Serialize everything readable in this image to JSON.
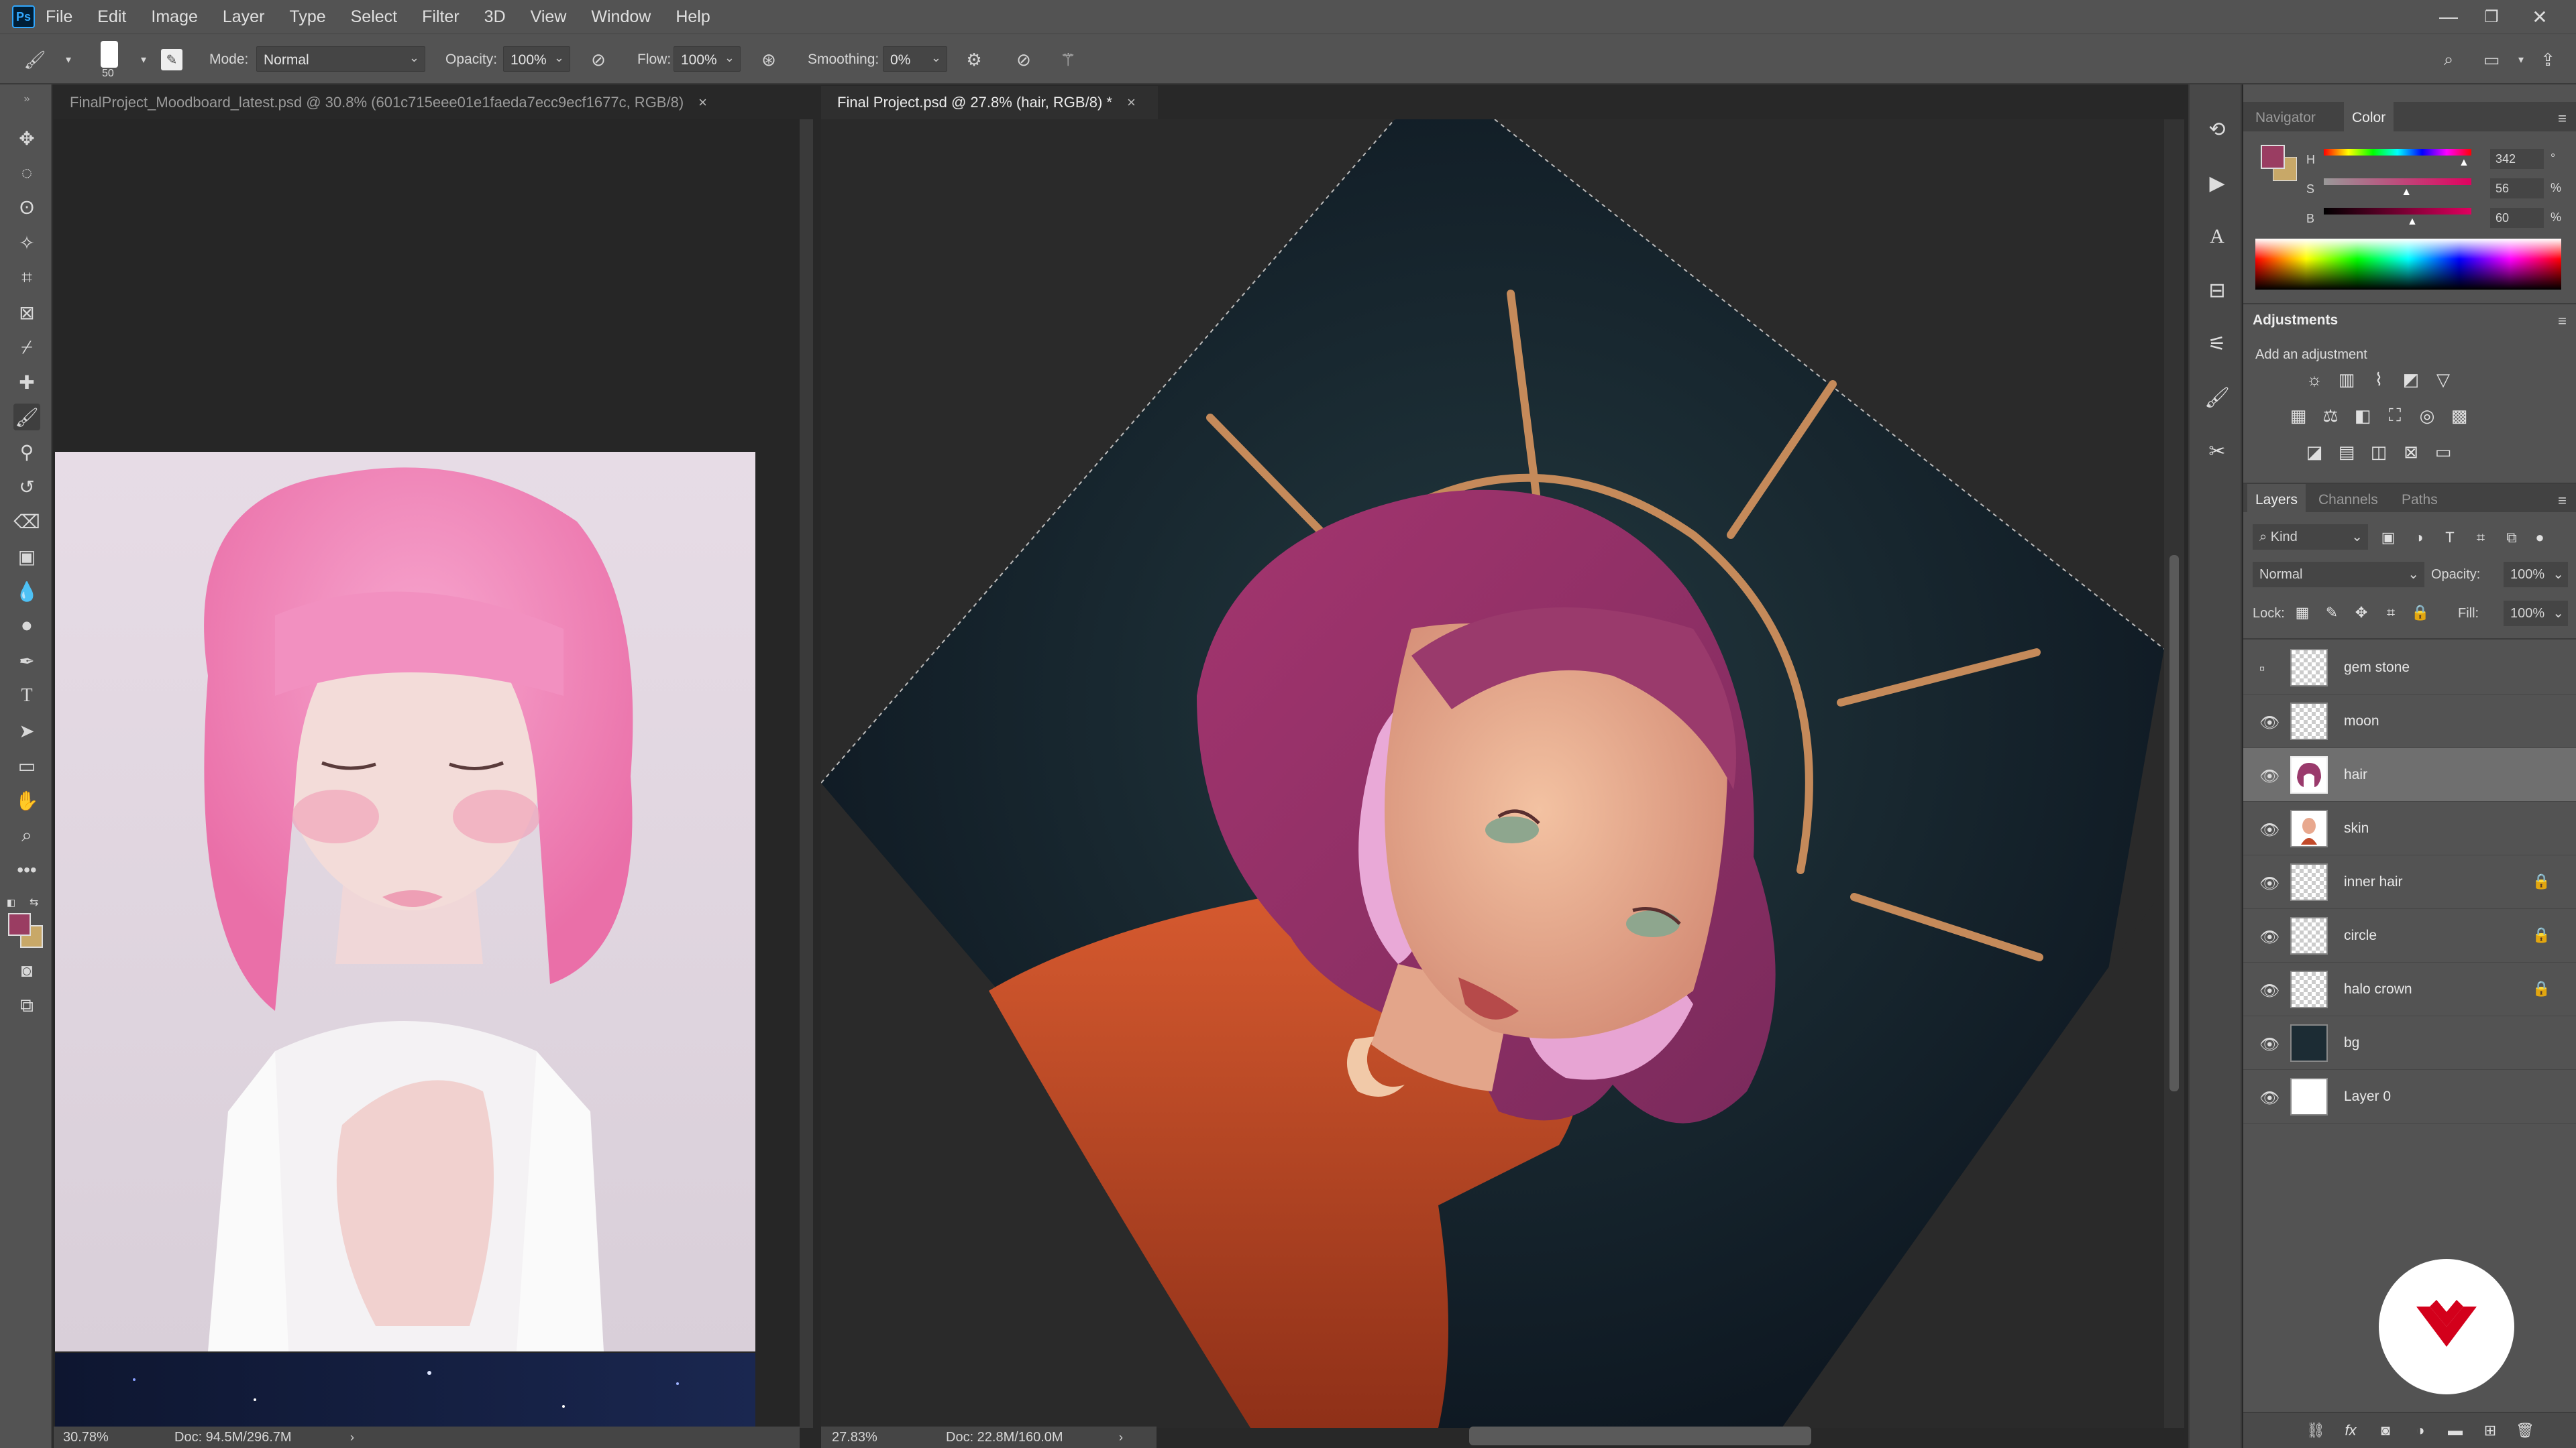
{
  "menu": [
    "File",
    "Edit",
    "Image",
    "Layer",
    "Type",
    "Select",
    "Filter",
    "3D",
    "View",
    "Window",
    "Help"
  ],
  "app_logo": "Ps",
  "window_controls": {
    "minimize": "—",
    "restore": "❐",
    "close": "✕"
  },
  "options": {
    "brush_size": "50",
    "mode_label": "Mode:",
    "mode_value": "Normal",
    "opacity_label": "Opacity:",
    "opacity_value": "100%",
    "flow_label": "Flow:",
    "flow_value": "100%",
    "smoothing_label": "Smoothing:",
    "smoothing_value": "0%"
  },
  "tabs": [
    {
      "title": "FinalProject_Moodboard_latest.psd @ 30.8% (601c715eee01e1faeda7ecc9ecf1677c, RGB/8)",
      "close": "×"
    },
    {
      "title": "Final Project.psd @ 27.8% (hair, RGB/8) *",
      "close": "×"
    }
  ],
  "status": {
    "doc1_zoom": "30.78%",
    "doc1_size": "Doc: 94.5M/296.7M",
    "doc2_zoom": "27.83%",
    "doc2_size": "Doc: 22.8M/160.0M"
  },
  "navigator_tabs": {
    "navigator": "Navigator",
    "color": "Color"
  },
  "color": {
    "h_label": "H",
    "h_value": "342",
    "h_unit": "°",
    "s_label": "S",
    "s_value": "56",
    "s_unit": "%",
    "b_label": "B",
    "b_value": "60",
    "b_unit": "%",
    "h_fraction": 0.95,
    "s_fraction": 0.56,
    "b_fraction": 0.6,
    "fg": "#9a3d62",
    "bg": "#c8a868"
  },
  "adjustments": {
    "title": "Adjustments",
    "subtitle": "Add an adjustment"
  },
  "layers_tabs": {
    "layers": "Layers",
    "channels": "Channels",
    "paths": "Paths"
  },
  "layers_controls": {
    "kind": "Kind",
    "blend": "Normal",
    "opacity_label": "Opacity:",
    "opacity_value": "100%",
    "lock_label": "Lock:",
    "fill_label": "Fill:",
    "fill_value": "100%"
  },
  "layers": [
    {
      "name": "gem stone",
      "visible": false,
      "locked": false
    },
    {
      "name": "moon",
      "visible": true,
      "locked": false
    },
    {
      "name": "hair",
      "visible": true,
      "locked": false,
      "selected": true
    },
    {
      "name": "skin",
      "visible": true,
      "locked": false
    },
    {
      "name": "inner hair",
      "visible": true,
      "locked": true
    },
    {
      "name": "circle",
      "visible": true,
      "locked": true
    },
    {
      "name": "halo crown",
      "visible": true,
      "locked": true
    },
    {
      "name": "bg",
      "visible": true,
      "locked": false
    },
    {
      "name": "Layer 0",
      "visible": true,
      "locked": false
    }
  ]
}
